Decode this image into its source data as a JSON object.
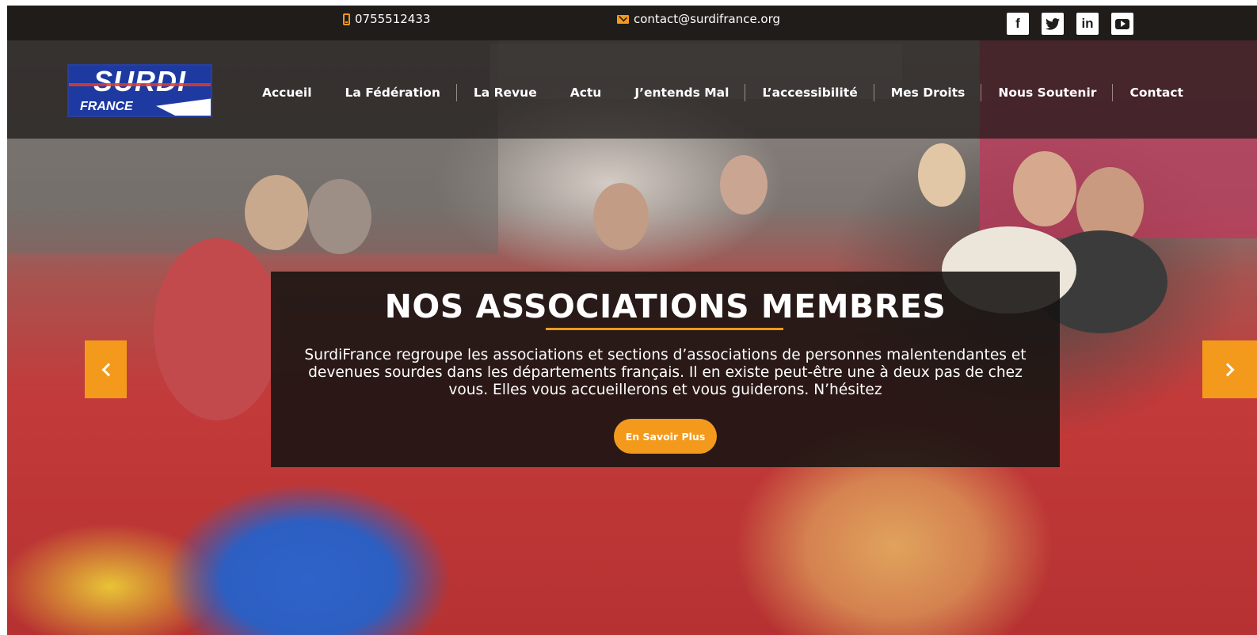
{
  "topbar": {
    "phone": "0755512433",
    "email": "contact@surdifrance.org",
    "social": [
      {
        "name": "facebook",
        "glyph": "f"
      },
      {
        "name": "twitter",
        "glyph": "t"
      },
      {
        "name": "linkedin",
        "glyph": "in"
      },
      {
        "name": "youtube",
        "glyph": ""
      }
    ]
  },
  "logo": {
    "brand": "SURDI",
    "sub": "FRANCE"
  },
  "nav": {
    "items": [
      "Accueil",
      "La Fédération",
      "La Revue",
      "Actu",
      "J’entends Mal",
      "L’accessibilité",
      "Mes Droits",
      "Nous Soutenir",
      "Contact"
    ]
  },
  "hero": {
    "title": "NOS ASSOCIATIONS MEMBRES",
    "description": "SurdiFrance regroupe les associations et sections d’associations de personnes malentendantes et devenues sourdes dans les départements français. Il en existe peut-être une à deux pas de chez vous. Elles vous accueillerons et vous guiderons. N’hésitez",
    "cta": "En Savoir Plus"
  },
  "colors": {
    "accent": "#f39a1d",
    "topbar": "#1f1c1a",
    "logo_blue": "#1e3aa0"
  }
}
